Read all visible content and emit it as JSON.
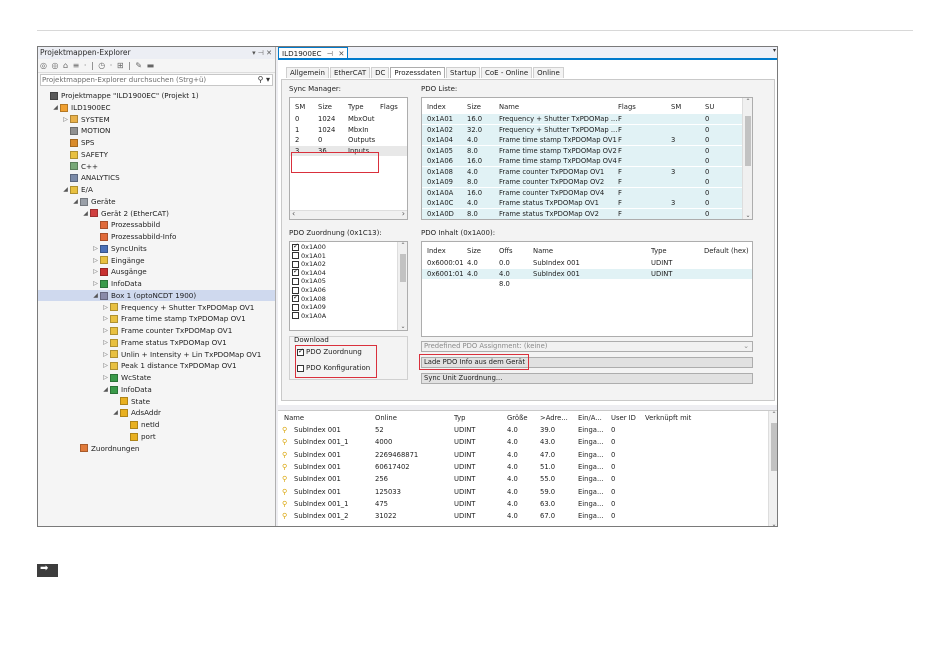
{
  "explorer": {
    "title": "Projektmappen-Explorer",
    "title_buttons": "▾ ⊣ ✕",
    "toolbar": "◎ ◎ ⌂ ≡ · | ◷ · ⊞ | ✎ ▬",
    "search_placeholder": "Projektmappen-Explorer durchsuchen (Strg+ü)",
    "search_icon": "⚲ ▾",
    "tree": [
      {
        "label": "Projektmappe \"ILD1900EC\" (Projekt 1)",
        "depth": 0,
        "arrow": "",
        "icon_color": "#5a5a5a",
        "icon": "solution-icon"
      },
      {
        "label": "ILD1900EC",
        "depth": 1,
        "arrow": "◢",
        "icon_color": "#f0a030",
        "icon": "project-icon"
      },
      {
        "label": "SYSTEM",
        "depth": 2,
        "arrow": "▷",
        "icon_color": "#e8b048",
        "icon": "system-icon"
      },
      {
        "label": "MOTION",
        "depth": 2,
        "arrow": "",
        "icon_color": "#909090",
        "icon": "motion-icon"
      },
      {
        "label": "SPS",
        "depth": 2,
        "arrow": "",
        "icon_color": "#d88a2a",
        "icon": "plc-icon"
      },
      {
        "label": "SAFETY",
        "depth": 2,
        "arrow": "",
        "icon_color": "#e8c040",
        "icon": "safety-icon"
      },
      {
        "label": "C++",
        "depth": 2,
        "arrow": "",
        "icon_color": "#78a878",
        "icon": "cpp-icon"
      },
      {
        "label": "ANALYTICS",
        "depth": 2,
        "arrow": "",
        "icon_color": "#7a8aa8",
        "icon": "analytics-icon"
      },
      {
        "label": "E/A",
        "depth": 2,
        "arrow": "◢",
        "icon_color": "#e8c040",
        "icon": "io-icon"
      },
      {
        "label": "Geräte",
        "depth": 3,
        "arrow": "◢",
        "icon_color": "#9aa0a8",
        "icon": "devices-icon"
      },
      {
        "label": "Gerät 2 (EtherCAT)",
        "depth": 4,
        "arrow": "◢",
        "icon_color": "#d04040",
        "icon": "ethercat-device-icon"
      },
      {
        "label": "Prozessabbild",
        "depth": 5,
        "arrow": "",
        "icon_color": "#e06a3a",
        "icon": "process-image-icon"
      },
      {
        "label": "Prozessabbild-Info",
        "depth": 5,
        "arrow": "",
        "icon_color": "#e06a3a",
        "icon": "process-image-info-icon"
      },
      {
        "label": "SyncUnits",
        "depth": 5,
        "arrow": "▷",
        "icon_color": "#4a70b8",
        "icon": "syncunits-icon"
      },
      {
        "label": "Eingänge",
        "depth": 5,
        "arrow": "▷",
        "icon_color": "#e8c040",
        "icon": "inputs-icon"
      },
      {
        "label": "Ausgänge",
        "depth": 5,
        "arrow": "▷",
        "icon_color": "#c83030",
        "icon": "outputs-icon"
      },
      {
        "label": "InfoData",
        "depth": 5,
        "arrow": "▷",
        "icon_color": "#3a9a4a",
        "icon": "infodata-icon"
      },
      {
        "label": "Box 1 (optoNCDT 1900)",
        "depth": 5,
        "arrow": "◢",
        "icon_color": "#8a8aa8",
        "icon": "box-icon",
        "selected": true
      },
      {
        "label": "Frequency + Shutter TxPDOMap OV1",
        "depth": 6,
        "arrow": "▷",
        "icon_color": "#e8c040",
        "icon": "pdo-icon"
      },
      {
        "label": "Frame time stamp TxPDOMap OV1",
        "depth": 6,
        "arrow": "▷",
        "icon_color": "#e8c040",
        "icon": "pdo-icon"
      },
      {
        "label": "Frame counter TxPDOMap OV1",
        "depth": 6,
        "arrow": "▷",
        "icon_color": "#e8c040",
        "icon": "pdo-icon"
      },
      {
        "label": "Frame status TxPDOMap OV1",
        "depth": 6,
        "arrow": "▷",
        "icon_color": "#e8c040",
        "icon": "pdo-icon"
      },
      {
        "label": "Unlin + Intensity + Lin TxPDOMap OV1",
        "depth": 6,
        "arrow": "▷",
        "icon_color": "#e8c040",
        "icon": "pdo-icon"
      },
      {
        "label": "Peak 1 distance TxPDOMap OV1",
        "depth": 6,
        "arrow": "▷",
        "icon_color": "#e8c040",
        "icon": "pdo-icon"
      },
      {
        "label": "WcState",
        "depth": 6,
        "arrow": "▷",
        "icon_color": "#3a9a4a",
        "icon": "wcstate-icon"
      },
      {
        "label": "InfoData",
        "depth": 6,
        "arrow": "◢",
        "icon_color": "#3a9a4a",
        "icon": "infodata-icon"
      },
      {
        "label": "State",
        "depth": 7,
        "arrow": "",
        "icon_color": "#e8b020",
        "icon": "variable-icon"
      },
      {
        "label": "AdsAddr",
        "depth": 7,
        "arrow": "◢",
        "icon_color": "#e8b020",
        "icon": "variable-icon"
      },
      {
        "label": "netId",
        "depth": 8,
        "arrow": "",
        "icon_color": "#e8b020",
        "icon": "variable-icon"
      },
      {
        "label": "port",
        "depth": 8,
        "arrow": "",
        "icon_color": "#e8b020",
        "icon": "variable-icon"
      },
      {
        "label": "Zuordnungen",
        "depth": 3,
        "arrow": "",
        "icon_color": "#e07a3a",
        "icon": "mappings-icon"
      }
    ]
  },
  "document": {
    "tab_label": "ILD1900EC",
    "tab_pin": "⊣",
    "tab_close": "✕",
    "overflow": "▾",
    "config_tabs": [
      {
        "label": "Allgemein",
        "active": false
      },
      {
        "label": "EtherCAT",
        "active": false
      },
      {
        "label": "DC",
        "active": false
      },
      {
        "label": "Prozessdaten",
        "active": true
      },
      {
        "label": "Startup",
        "active": false
      },
      {
        "label": "CoE - Online",
        "active": false
      },
      {
        "label": "Online",
        "active": false
      }
    ],
    "sync_manager": {
      "label": "Sync Manager:",
      "headers": [
        "SM",
        "Size",
        "Type",
        "Flags"
      ],
      "rows": [
        [
          "0",
          "1024",
          "MbxOut",
          ""
        ],
        [
          "1",
          "1024",
          "MbxIn",
          ""
        ],
        [
          "2",
          "0",
          "Outputs",
          ""
        ],
        [
          "3",
          "36",
          "Inputs",
          ""
        ]
      ]
    },
    "pdo_list": {
      "label": "PDO Liste:",
      "headers": [
        "Index",
        "Size",
        "Name",
        "Flags",
        "SM",
        "SU"
      ],
      "rows": [
        [
          "0x1A01",
          "16.0",
          "Frequency + Shutter TxPDOMap ...",
          "F",
          "",
          "0"
        ],
        [
          "0x1A02",
          "32.0",
          "Frequency + Shutter TxPDOMap ...",
          "F",
          "",
          "0"
        ],
        [
          "0x1A04",
          "4.0",
          "Frame time stamp TxPDOMap OV1",
          "F",
          "3",
          "0"
        ],
        [
          "0x1A05",
          "8.0",
          "Frame time stamp TxPDOMap OV2",
          "F",
          "",
          "0"
        ],
        [
          "0x1A06",
          "16.0",
          "Frame time stamp TxPDOMap OV4",
          "F",
          "",
          "0"
        ],
        [
          "0x1A08",
          "4.0",
          "Frame counter TxPDOMap OV1",
          "F",
          "3",
          "0"
        ],
        [
          "0x1A09",
          "8.0",
          "Frame counter TxPDOMap OV2",
          "F",
          "",
          "0"
        ],
        [
          "0x1A0A",
          "16.0",
          "Frame counter TxPDOMap OV4",
          "F",
          "",
          "0"
        ],
        [
          "0x1A0C",
          "4.0",
          "Frame status TxPDOMap OV1",
          "F",
          "3",
          "0"
        ],
        [
          "0x1A0D",
          "8.0",
          "Frame status TxPDOMap OV2",
          "F",
          "",
          "0"
        ]
      ]
    },
    "pdo_assignment": {
      "label": "PDO Zuordnung (0x1C13):",
      "items": [
        {
          "label": "0x1A00",
          "checked": true
        },
        {
          "label": "0x1A01",
          "checked": false
        },
        {
          "label": "0x1A02",
          "checked": false
        },
        {
          "label": "0x1A04",
          "checked": true
        },
        {
          "label": "0x1A05",
          "checked": false
        },
        {
          "label": "0x1A06",
          "checked": false
        },
        {
          "label": "0x1A08",
          "checked": true
        },
        {
          "label": "0x1A09",
          "checked": false
        },
        {
          "label": "0x1A0A",
          "checked": false
        }
      ]
    },
    "pdo_content": {
      "label": "PDO Inhalt (0x1A00):",
      "headers": [
        "Index",
        "Size",
        "Offs",
        "Name",
        "Type",
        "Default (hex)"
      ],
      "rows": [
        [
          "0x6000:01",
          "4.0",
          "0.0",
          "SubIndex 001",
          "UDINT",
          ""
        ],
        [
          "0x6001:01",
          "4.0",
          "4.0",
          "SubIndex 001",
          "UDINT",
          ""
        ],
        [
          "",
          "",
          "8.0",
          "",
          "",
          ""
        ]
      ]
    },
    "download": {
      "label": "Download",
      "pdo_assignment": {
        "label": "PDO Zuordnung",
        "checked": true
      },
      "pdo_configuration": {
        "label": "PDO Konfiguration",
        "checked": false
      }
    },
    "predefined_label": "Predefined PDO Assignment: (keine)",
    "load_button": "Lade PDO Info aus dem Gerät",
    "sync_unit_button": "Sync Unit Zuordnung..."
  },
  "variables": {
    "headers": [
      "Name",
      "Online",
      "Typ",
      "Größe",
      ">Adre...",
      "Ein/A...",
      "User ID",
      "Verknüpft mit"
    ],
    "rows": [
      [
        "SubIndex 001",
        "52",
        "UDINT",
        "4.0",
        "39.0",
        "Einga...",
        "0",
        ""
      ],
      [
        "SubIndex 001_1",
        "4000",
        "UDINT",
        "4.0",
        "43.0",
        "Einga...",
        "0",
        ""
      ],
      [
        "SubIndex 001",
        "2269468871",
        "UDINT",
        "4.0",
        "47.0",
        "Einga...",
        "0",
        ""
      ],
      [
        "SubIndex 001",
        "60617402",
        "UDINT",
        "4.0",
        "51.0",
        "Einga...",
        "0",
        ""
      ],
      [
        "SubIndex 001",
        "256",
        "UDINT",
        "4.0",
        "55.0",
        "Einga...",
        "0",
        ""
      ],
      [
        "SubIndex 001",
        "125033",
        "UDINT",
        "4.0",
        "59.0",
        "Einga...",
        "0",
        ""
      ],
      [
        "SubIndex 001_1",
        "475",
        "UDINT",
        "4.0",
        "63.0",
        "Einga...",
        "0",
        ""
      ],
      [
        "SubIndex 001_2",
        "31022",
        "UDINT",
        "4.0",
        "67.0",
        "Einga...",
        "0",
        ""
      ]
    ]
  },
  "footer_icon": "arrow-right-icon"
}
